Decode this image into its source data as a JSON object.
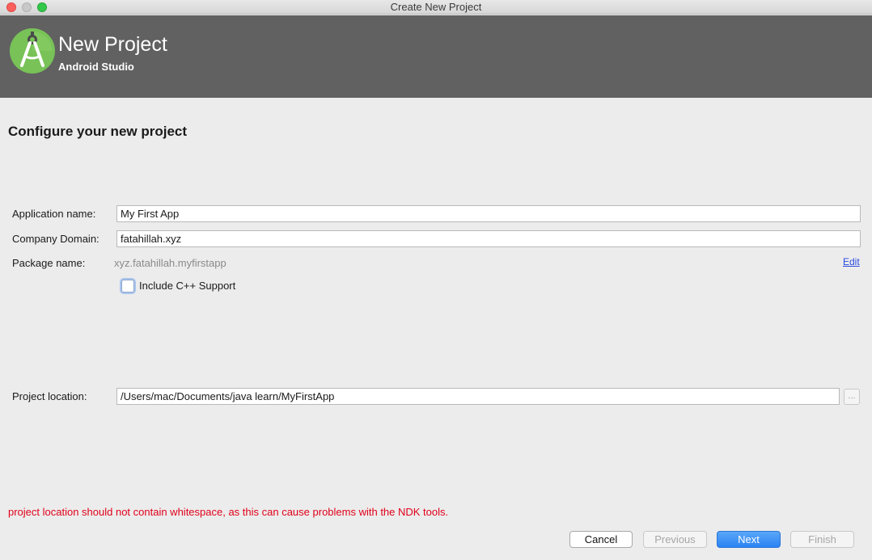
{
  "window": {
    "title": "Create New Project"
  },
  "header": {
    "title": "New Project",
    "subtitle": "Android Studio",
    "logo_icon": "android-studio-logo-icon"
  },
  "page_title": "Configure your new project",
  "form": {
    "app_name_label": "Application name:",
    "app_name_value": "My First App",
    "company_domain_label": "Company Domain:",
    "company_domain_value": "fatahillah.xyz",
    "package_name_label": "Package name:",
    "package_name_value": "xyz.fatahillah.myfirstapp",
    "edit_link": "Edit",
    "cpp_support_label": "Include C++ Support",
    "cpp_support_checked": false,
    "project_location_label": "Project location:",
    "project_location_value": "/Users/mac/Documents/java learn/MyFirstApp",
    "browse_label": "..."
  },
  "error_message": "project location should not contain whitespace, as this can cause problems with the NDK tools.",
  "buttons": {
    "cancel": "Cancel",
    "previous": "Previous",
    "next": "Next",
    "finish": "Finish"
  },
  "colors": {
    "header_bg": "#616161",
    "error": "#e0001a",
    "primary_button": "#2a83f3",
    "logo_green": "#78c257"
  }
}
